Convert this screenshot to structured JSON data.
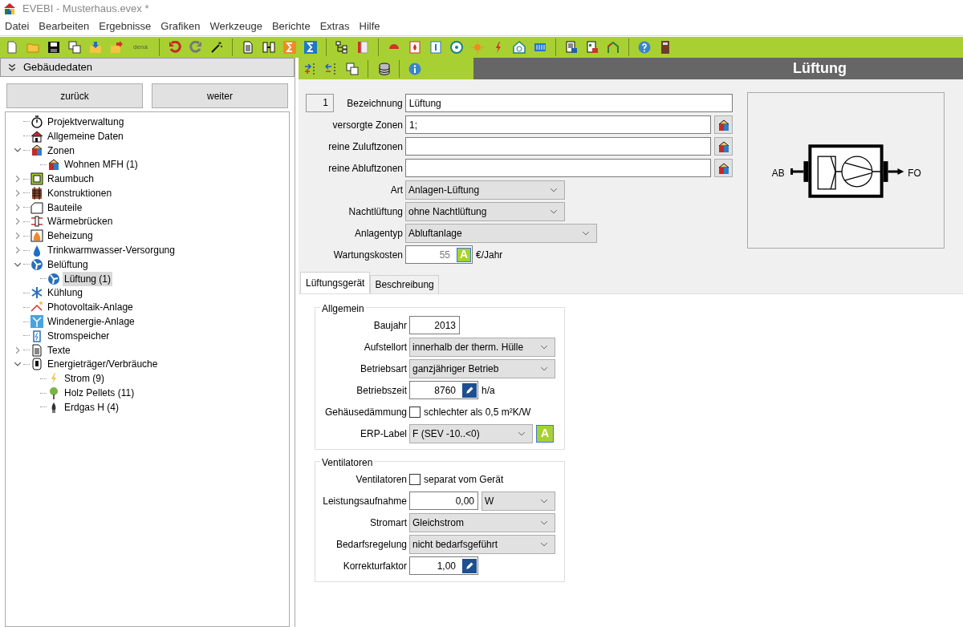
{
  "window": {
    "title": "EVEBI - Musterhaus.evex *"
  },
  "menu": [
    "Datei",
    "Bearbeiten",
    "Ergebnisse",
    "Grafiken",
    "Werkzeuge",
    "Berichte",
    "Extras",
    "Hilfe"
  ],
  "toolbar": {
    "dena_label": "dena"
  },
  "left_panel": {
    "title": "Gebäudedaten",
    "buttons": [
      "zurück",
      "weiter"
    ],
    "tree": [
      {
        "label": "Projektverwaltung",
        "selected": false
      },
      {
        "label": "Allgemeine Daten",
        "selected": false
      },
      {
        "label": "Zonen",
        "expanded": true,
        "selected": false,
        "children": [
          {
            "label": "Wohnen MFH (1)",
            "selected": false
          }
        ]
      },
      {
        "label": "Raumbuch",
        "expanded": false,
        "selected": false
      },
      {
        "label": "Konstruktionen",
        "expanded": false,
        "selected": false
      },
      {
        "label": "Bauteile",
        "expanded": false,
        "selected": false
      },
      {
        "label": "Wärmebrücken",
        "expanded": false,
        "selected": false
      },
      {
        "label": "Beheizung",
        "expanded": false,
        "selected": false
      },
      {
        "label": "Trinkwarmwasser-Versorgung",
        "expanded": false,
        "selected": false
      },
      {
        "label": "Belüftung",
        "expanded": true,
        "selected": false,
        "children": [
          {
            "label": "Lüftung (1)",
            "selected": true
          }
        ]
      },
      {
        "label": "Kühlung",
        "selected": false
      },
      {
        "label": "Photovoltaik-Anlage",
        "selected": false
      },
      {
        "label": "Windenergie-Anlage",
        "selected": false
      },
      {
        "label": "Stromspeicher",
        "selected": false
      },
      {
        "label": "Texte",
        "expanded": false,
        "selected": false
      },
      {
        "label": "Energieträger/Verbräuche",
        "expanded": true,
        "selected": false,
        "children": [
          {
            "label": "Strom (9)",
            "selected": false
          },
          {
            "label": "Holz Pellets (11)",
            "selected": false
          },
          {
            "label": "Erdgas H (4)",
            "selected": false
          }
        ]
      }
    ]
  },
  "header": {
    "title": "Lüftung"
  },
  "form": {
    "record_number": "1",
    "fields": [
      {
        "kind": "text",
        "label": "Bezeichnung",
        "value": "Lüftung"
      },
      {
        "kind": "zones",
        "label": "versorgte Zonen",
        "value": "1;"
      },
      {
        "kind": "zones",
        "label": "reine Zuluftzonen"
      },
      {
        "kind": "zones",
        "label": "reine Abluftzonen"
      },
      {
        "kind": "select",
        "label": "Art",
        "value": "Anlagen-Lüftung"
      },
      {
        "kind": "select",
        "label": "Nachtlüftung",
        "value": "ohne Nachtlüftung"
      },
      {
        "kind": "wideselect",
        "label": "Anlagentyp",
        "value": "Abluftanlage"
      },
      {
        "kind": "cost",
        "label": "Wartungskosten",
        "value": "55",
        "button": "A",
        "unit": "€/Jahr"
      }
    ]
  },
  "diagram": {
    "inlet_label": "AB",
    "outlet_label": "FO"
  },
  "tabs": [
    {
      "label": "Lüftungsgerät",
      "selected": true
    },
    {
      "label": "Beschreibung",
      "selected": false
    }
  ],
  "groups": [
    {
      "title": "Allgemein",
      "rows": [
        {
          "kind": "number",
          "label": "Baujahr",
          "value": "2013"
        },
        {
          "kind": "select",
          "label": "Aufstellort",
          "value": "innerhalb der therm. Hülle"
        },
        {
          "kind": "select",
          "label": "Betriebsart",
          "value": "ganzjähriger Betrieb"
        },
        {
          "kind": "edit",
          "label": "Betriebszeit",
          "value": "8760",
          "unit": "h/a"
        },
        {
          "kind": "checkbox",
          "label": "Gehäusedämmung",
          "text": "schlechter als 0,5 m²K/W",
          "checked": false
        },
        {
          "kind": "selectbutton",
          "label": "ERP-Label",
          "value": "F (SEV -10..<0)",
          "button": "A"
        }
      ]
    },
    {
      "title": "Ventilatoren",
      "rows": [
        {
          "kind": "checkbox",
          "label": "Ventilatoren",
          "text": "separat vom Gerät",
          "checked": false
        },
        {
          "kind": "numberselect",
          "label": "Leistungsaufnahme",
          "value": "0,00",
          "unit": "W"
        },
        {
          "kind": "select",
          "label": "Stromart",
          "value": "Gleichstrom"
        },
        {
          "kind": "select",
          "label": "Bedarfsregelung",
          "value": "nicht bedarfsgeführt"
        },
        {
          "kind": "edit",
          "label": "Korrekturfaktor",
          "value": "1,00"
        }
      ]
    }
  ]
}
